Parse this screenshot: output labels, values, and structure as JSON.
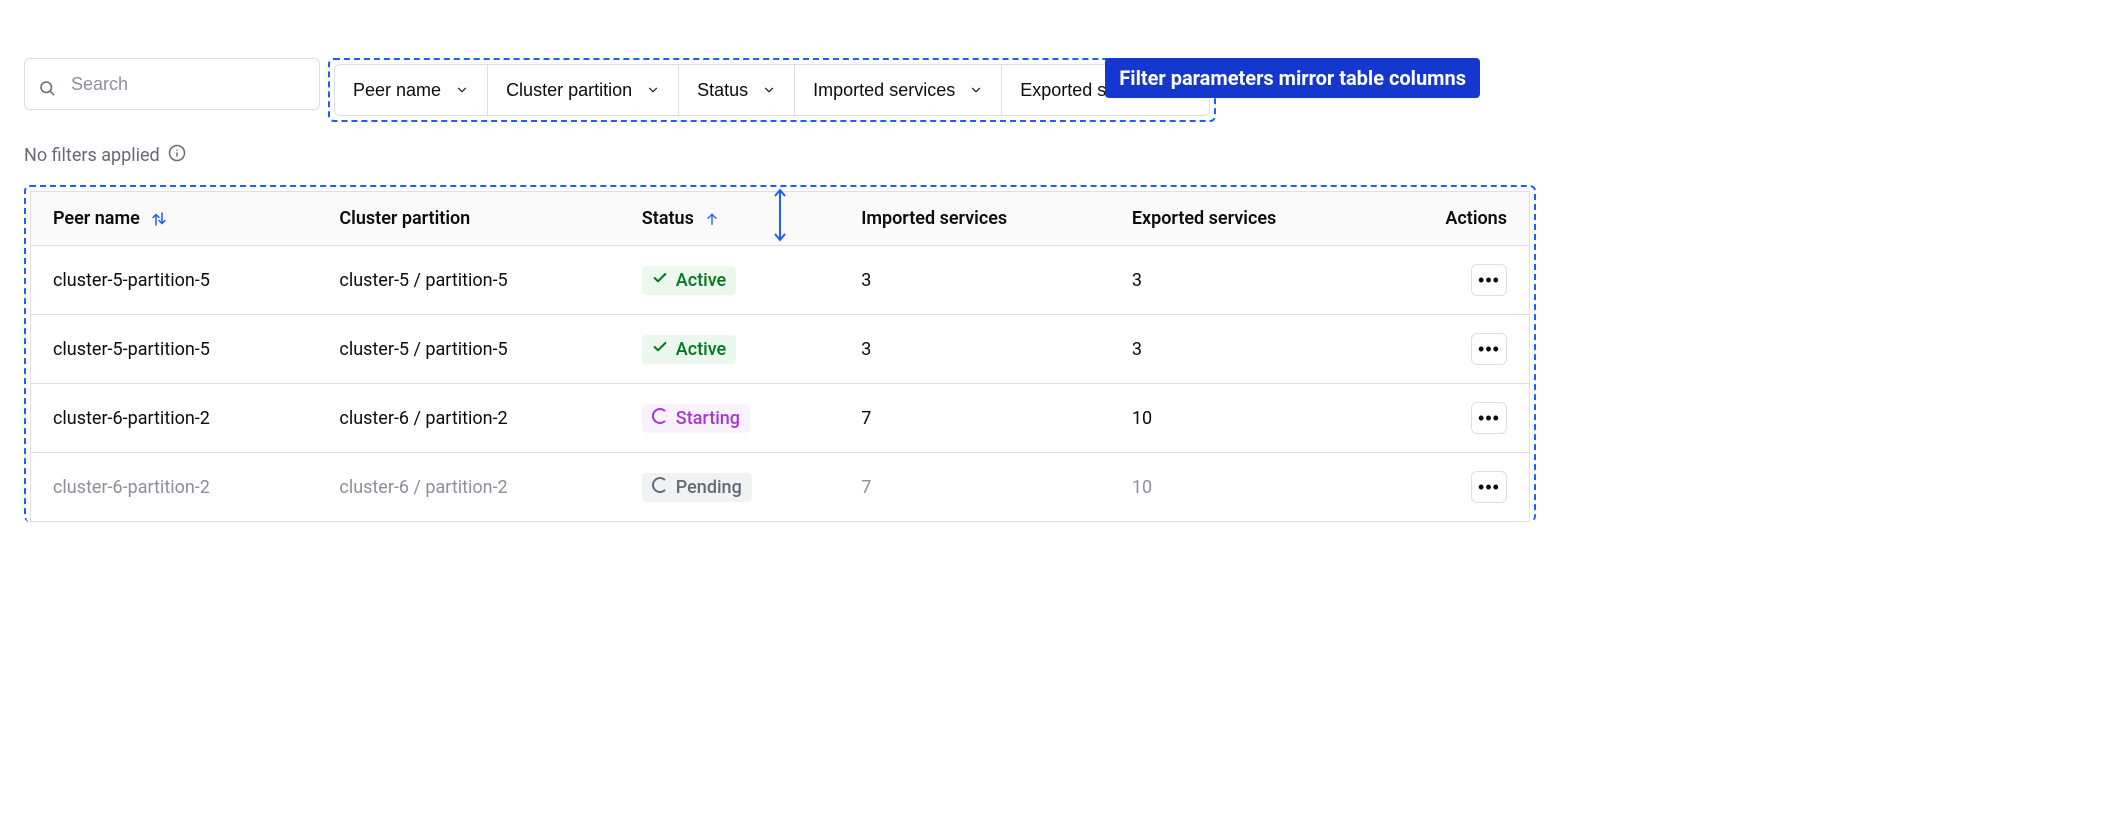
{
  "annotation": {
    "label": "Filter parameters mirror table columns"
  },
  "search": {
    "placeholder": "Search",
    "value": ""
  },
  "filters": [
    {
      "label": "Peer name"
    },
    {
      "label": "Cluster partition"
    },
    {
      "label": "Status"
    },
    {
      "label": "Imported services"
    },
    {
      "label": "Exported services"
    }
  ],
  "filters_applied_text": "No filters applied",
  "columns": {
    "peer_name": "Peer name",
    "cluster_partition": "Cluster partition",
    "status": "Status",
    "imported": "Imported services",
    "exported": "Exported services",
    "actions": "Actions"
  },
  "rows": [
    {
      "peer": "cluster-5-partition-5",
      "partition": "cluster-5 / partition-5",
      "status": "Active",
      "status_kind": "active",
      "imported": "3",
      "exported": "3",
      "muted": false
    },
    {
      "peer": "cluster-5-partition-5",
      "partition": "cluster-5 / partition-5",
      "status": "Active",
      "status_kind": "active",
      "imported": "3",
      "exported": "3",
      "muted": false
    },
    {
      "peer": "cluster-6-partition-2",
      "partition": "cluster-6 / partition-2",
      "status": "Starting",
      "status_kind": "starting",
      "imported": "7",
      "exported": "10",
      "muted": false
    },
    {
      "peer": "cluster-6-partition-2",
      "partition": "cluster-6 / partition-2",
      "status": "Pending",
      "status_kind": "pending",
      "imported": "7",
      "exported": "10",
      "muted": true
    }
  ]
}
